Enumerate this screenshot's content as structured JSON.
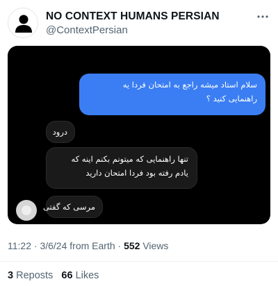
{
  "author": {
    "display_name": "NO CONTEXT HUMANS PERSIAN",
    "handle": "@ContextPersian",
    "avatar_icon": "person-silhouette-icon"
  },
  "chat": {
    "outgoing_message": "سلام استاد میشه راجع به امتحان فردا یه\nراهنمایی کنید ؟",
    "reply_greeting": "درود",
    "reply_main": "تنها راهنمایی که میتونم بکنم اینه که\nیادم رفته بود فردا امتحان دارید",
    "reply_thanks": "مرسی که گفتی"
  },
  "meta": {
    "time": "11:22",
    "date": "3/6/24",
    "source": "from Earth",
    "separator": "·",
    "views_count": "552",
    "views_label": "Views"
  },
  "stats": {
    "reposts_count": "3",
    "reposts_label": "Reposts",
    "likes_count": "66",
    "likes_label": "Likes"
  },
  "colors": {
    "outgoing_bubble": "#3b7ef3",
    "incoming_bubble": "#1a1a1a",
    "chat_background": "#000000",
    "muted_text": "#536471"
  }
}
